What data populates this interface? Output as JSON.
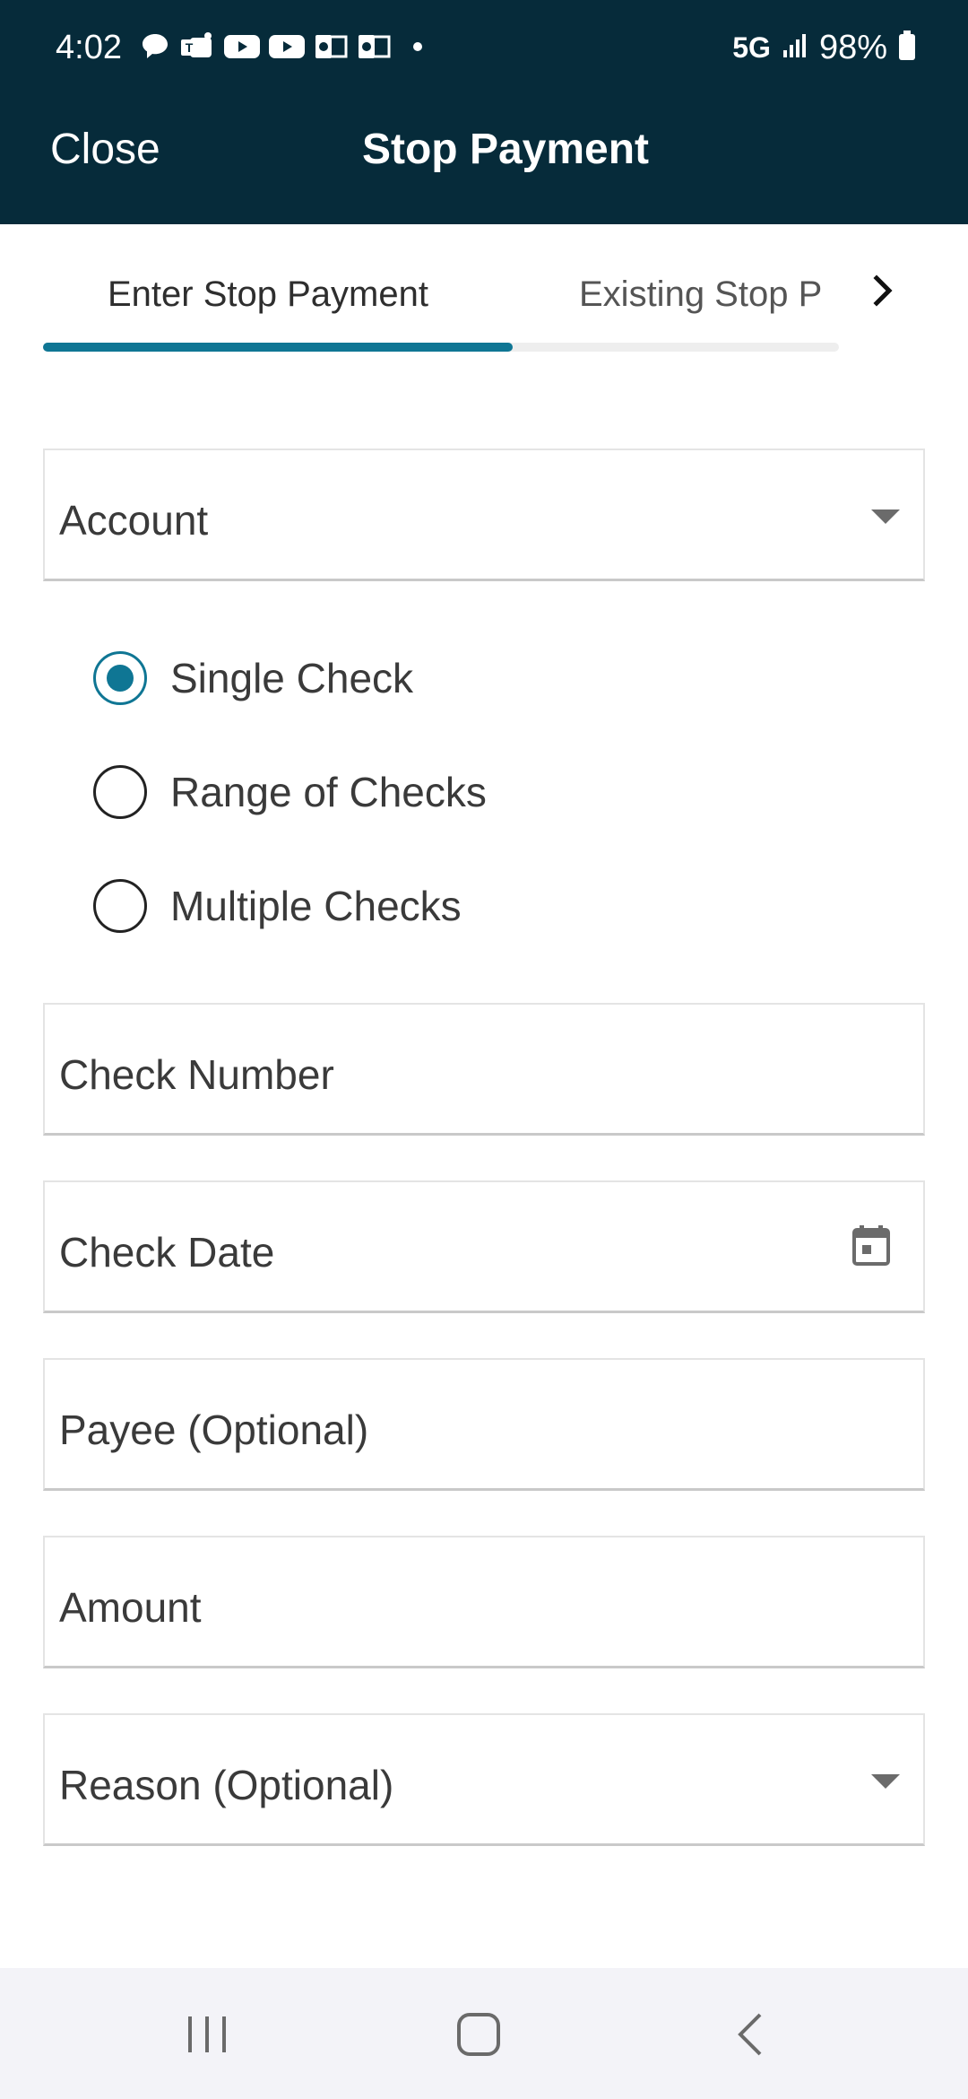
{
  "status_bar": {
    "time": "4:02",
    "network": "5G",
    "battery": "98%",
    "notification_icons": [
      "chat-icon",
      "teams-icon",
      "youtube-icon",
      "youtube-icon",
      "outlook-icon",
      "outlook-icon",
      "dot-icon"
    ]
  },
  "app_bar": {
    "close_label": "Close",
    "title": "Stop Payment",
    "background": "#062b3a"
  },
  "tabs": {
    "items": [
      {
        "label": "Enter Stop Payment",
        "selected": true
      },
      {
        "label": "Existing Stop P",
        "selected": false
      }
    ],
    "accent": "#0f7694"
  },
  "form": {
    "account_label": "Account",
    "check_type_options": [
      {
        "label": "Single Check",
        "selected": true
      },
      {
        "label": "Range of Checks",
        "selected": false
      },
      {
        "label": "Multiple Checks",
        "selected": false
      }
    ],
    "check_number_label": "Check Number",
    "check_date_label": "Check Date",
    "payee_label": "Payee (Optional)",
    "amount_label": "Amount",
    "reason_label": "Reason (Optional)"
  },
  "nav_bar": {
    "buttons": [
      "recent-apps-icon",
      "home-icon",
      "back-icon"
    ]
  }
}
